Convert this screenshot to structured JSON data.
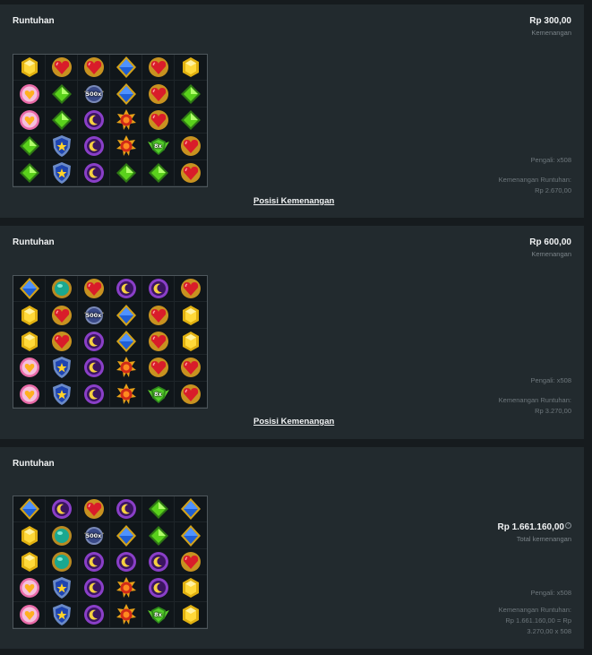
{
  "rounds": [
    {
      "title": "Runtuhan",
      "amount": "Rp 300,00",
      "amount_label": "Kemenangan",
      "multiplier": "Pengali: x508",
      "cascade_label": "Kemenangan Runtuhan:",
      "cascade_value": "Rp 2.670,00",
      "cascade_value_2": "",
      "win_link": "Posisi Kemenangan",
      "grid": [
        [
          "yellow-gem",
          "heart-gem",
          "heart-gem",
          "blue-gem",
          "heart-gem",
          "yellow-gem"
        ],
        [
          "pink-heart",
          "green-gem",
          "bomb",
          "blue-gem",
          "heart-gem",
          "green-gem"
        ],
        [
          "pink-heart",
          "green-gem",
          "purple-moon",
          "sun-gem",
          "heart-gem",
          "green-gem"
        ],
        [
          "green-gem",
          "blue-star",
          "purple-moon",
          "sun-gem",
          "bomb-green",
          "heart-gem"
        ],
        [
          "green-gem",
          "blue-star",
          "purple-moon",
          "green-gem",
          "green-gem",
          "heart-gem"
        ]
      ],
      "bomb_labels": {
        "r1c2": "500x",
        "r3c4": "8x"
      }
    },
    {
      "title": "Runtuhan",
      "amount": "Rp 600,00",
      "amount_label": "Kemenangan",
      "multiplier": "Pengali: x508",
      "cascade_label": "Kemenangan Runtuhan:",
      "cascade_value": "Rp 3.270,00",
      "cascade_value_2": "",
      "win_link": "Posisi Kemenangan",
      "grid": [
        [
          "blue-gem",
          "teal-gem",
          "heart-gem",
          "purple-moon",
          "purple-moon",
          "heart-gem"
        ],
        [
          "yellow-gem",
          "heart-gem",
          "bomb",
          "blue-gem",
          "heart-gem",
          "yellow-gem"
        ],
        [
          "yellow-gem",
          "heart-gem",
          "purple-moon",
          "blue-gem",
          "heart-gem",
          "yellow-gem"
        ],
        [
          "pink-heart",
          "blue-star",
          "purple-moon",
          "sun-gem",
          "heart-gem",
          "heart-gem"
        ],
        [
          "pink-heart",
          "blue-star",
          "purple-moon",
          "sun-gem",
          "bomb-green",
          "heart-gem"
        ]
      ],
      "bomb_labels": {
        "r1c2": "500x",
        "r4c4": "8x"
      }
    },
    {
      "title": "Runtuhan",
      "amount": "Rp 1.661.160,00",
      "amount_label": "Total kemenangan",
      "multiplier": "Pengali: x508",
      "cascade_label": "Kemenangan Runtuhan:",
      "cascade_value": "Rp 1.661.160,00 = Rp",
      "cascade_value_2": "3.270,00 x 508",
      "win_link": "",
      "grid": [
        [
          "blue-gem",
          "purple-moon",
          "heart-gem",
          "purple-moon",
          "green-gem",
          "blue-gem"
        ],
        [
          "yellow-gem",
          "teal-gem",
          "bomb",
          "blue-gem",
          "green-gem",
          "blue-gem"
        ],
        [
          "yellow-gem",
          "teal-gem",
          "purple-moon",
          "purple-moon",
          "purple-moon",
          "heart-gem"
        ],
        [
          "pink-heart",
          "blue-star",
          "purple-moon",
          "sun-gem",
          "purple-moon",
          "yellow-gem"
        ],
        [
          "pink-heart",
          "blue-star",
          "purple-moon",
          "sun-gem",
          "bomb-green",
          "yellow-gem"
        ]
      ],
      "bomb_labels": {
        "r1c2": "500x",
        "r4c4": "8x"
      }
    }
  ],
  "colors": {
    "panel_bg": "#222a2e",
    "page_bg": "#161b1e",
    "grid_bg": "#10161a"
  }
}
